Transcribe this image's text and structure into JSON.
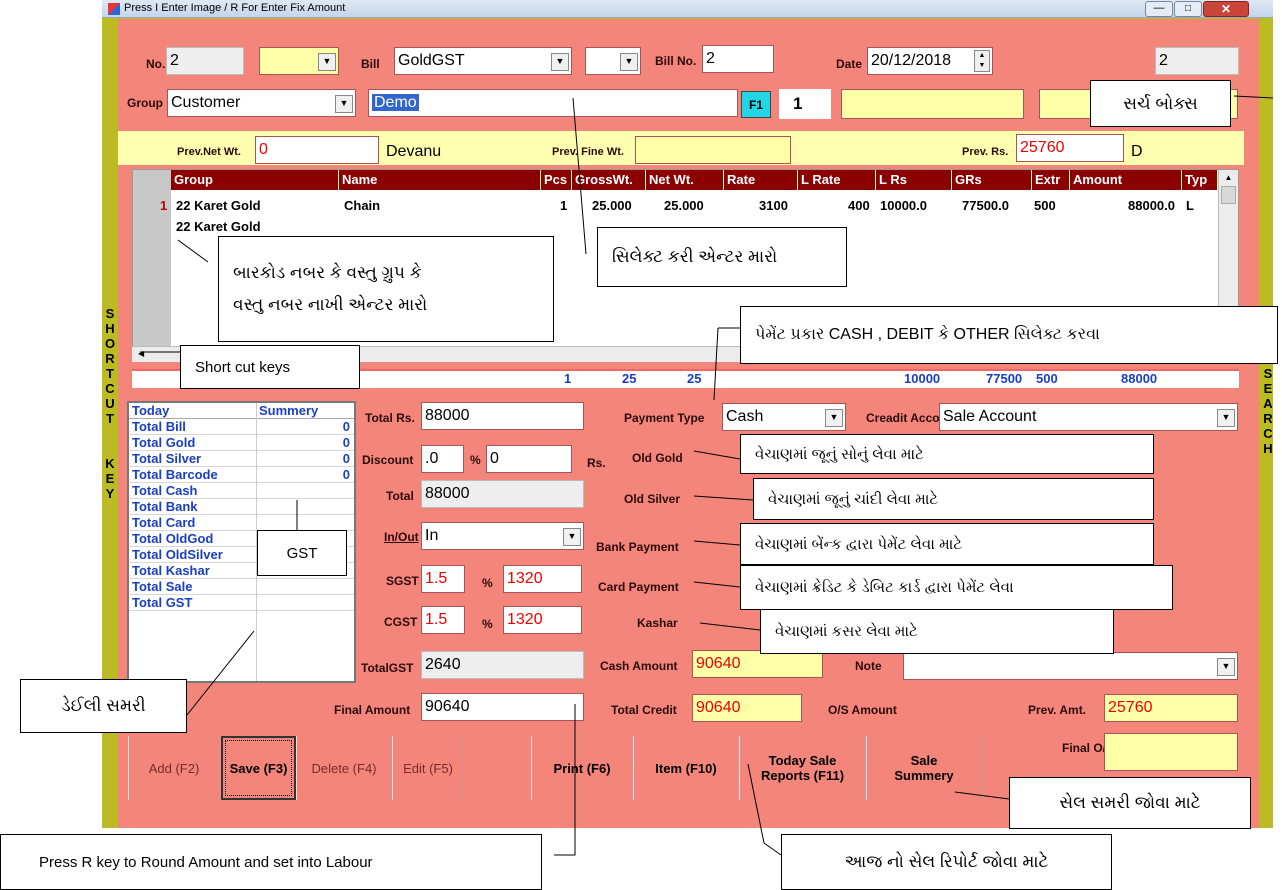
{
  "titlebar": {
    "title": "Press I Enter Image / R  For Enter Fix Amount"
  },
  "header": {
    "no_label": "No.",
    "no_value": "2",
    "bill_label": "Bill",
    "bill_value": "GoldGST",
    "billno_label": "Bill No.",
    "billno_value": "2",
    "date_label": "Date",
    "date_value": "20/12/2018",
    "right_value": "2",
    "group_label": "Group",
    "group_value": "Customer",
    "name_value": "Demo",
    "f1_label": "F1",
    "count_value": "1"
  },
  "prev": {
    "net_label": "Prev.Net Wt.",
    "net_value": "0",
    "devanu": "Devanu",
    "fine_label": "Prev. Fine Wt.",
    "rs_label": "Prev. Rs.",
    "rs_value": "25760",
    "d": "D"
  },
  "grid": {
    "columns": [
      "Group",
      "Name",
      "Pcs",
      "GrossWt.",
      "Net Wt.",
      "Rate",
      "L Rate",
      "L Rs",
      "GRs",
      "Extr",
      "Amount",
      "Typ"
    ],
    "rows": [
      {
        "no": "1",
        "group": "22 Karet Gold",
        "name": "Chain",
        "pcs": "1",
        "gross": "25.000",
        "net": "25.000",
        "rate": "3100",
        "lrate": "400",
        "lrs": "10000.0",
        "grs": "77500.0",
        "extr": "500",
        "amount": "88000.0",
        "typ": "L"
      },
      {
        "no": "",
        "group": "22 Karet Gold",
        "name": "",
        "pcs": "",
        "gross": "",
        "net": "",
        "rate": "",
        "lrate": "",
        "lrs": "",
        "grs": "",
        "extr": "",
        "amount": "",
        "typ": ""
      }
    ],
    "totals": {
      "pcs": "1",
      "gross": "25",
      "net": "25",
      "lrs": "10000",
      "grs": "77500",
      "extr": "500",
      "amount": "88000"
    }
  },
  "summary": {
    "header_left": "Today",
    "header_right": "Summery",
    "rows": [
      {
        "label": "Total Bill",
        "value": "0"
      },
      {
        "label": "Total Gold",
        "value": "0"
      },
      {
        "label": "Total Silver",
        "value": "0"
      },
      {
        "label": "Total Barcode",
        "value": "0"
      },
      {
        "label": "Total Cash",
        "value": ""
      },
      {
        "label": "Total Bank",
        "value": ""
      },
      {
        "label": "Total Card",
        "value": ""
      },
      {
        "label": "Total OldGod",
        "value": ""
      },
      {
        "label": "Total OldSilver",
        "value": ""
      },
      {
        "label": "Total Kashar",
        "value": ""
      },
      {
        "label": "Total Sale",
        "value": ""
      },
      {
        "label": "Total GST",
        "value": ""
      }
    ]
  },
  "form": {
    "totalrs_label": "Total Rs.",
    "totalrs_value": "88000",
    "discount_label": "Discount",
    "discount_value": ".0",
    "pct": "%",
    "discount_pct_value": "0",
    "rs": "Rs.",
    "total_label": "Total",
    "total_value": "88000",
    "inout_label": "In/Out",
    "inout_value": "In",
    "sgst_label": "SGST",
    "sgst_rate": "1.5",
    "sgst_amount": "1320",
    "cgst_label": "CGST",
    "cgst_rate": "1.5",
    "cgst_amount": "1320",
    "totalgst_label": "TotalGST",
    "totalgst_value": "2640",
    "final_label": "Final Amount",
    "final_value": "90640",
    "paytype_label": "Payment Type",
    "paytype_value": "Cash",
    "credit_label": "Creadit Account",
    "credit_value": "Sale Account",
    "oldgold_label": "Old Gold",
    "oldsilver_label": "Old Silver",
    "bankpay_label": "Bank Payment",
    "cardpay_label": "Card Payment",
    "kashar_label": "Kashar",
    "cash_label": "Cash Amount",
    "cash_value": "90640",
    "note_label": "Note",
    "totalcredit_label": "Total Credit",
    "totalcredit_value": "90640",
    "os_label": "O/S Amount",
    "prevamt_label": "Prev. Amt.",
    "prevamt_value": "25760",
    "finalos_label": "Final O/S"
  },
  "buttons": {
    "add": "Add (F2)",
    "save": "Save (F3)",
    "delete": "Delete (F4)",
    "edit": "Edit (F5)",
    "print": "Print (F6)",
    "item": "Item (F10)",
    "today": "Today Sale\nReports (F11)",
    "summery": "Sale\nSummery"
  },
  "side": {
    "left": "SHORTCUT KEY",
    "right": "SEARCH"
  },
  "callouts": {
    "search_box": "સર્ચ બોક્સ",
    "barcode": "બારકોડ નબર કે વસ્તુ ગ્રુપ કે\nવસ્તુ નબર નાખી એન્ટર મારો",
    "select_enter": "સિલેક્ટ કરી એન્ટર મારો",
    "payment_type": "પેમેંટ પ્રકાર CASH , DEBIT કે OTHER સિલેક્ટ કરવા",
    "shortcut": "Short cut keys",
    "old_gold": "વેચાણમાં જૂનું સોનું લેવા માટે",
    "old_silver": "વેચાણમાં જૂનું ચાંદી લેવા માટે",
    "bank": "વેચાણમાં બેંન્ક દ્વારા પેમેંટ લેવા માટે",
    "card": "વેચાણમાં ક્રેડિટ કે ડેબિટ કાર્ડ દ્વારા પેમેંટ લેવા",
    "kashar": "વેચાણમાં કસર લેવા માટે",
    "gst": "GST",
    "daily": "ડેઈલી સમરી",
    "sale_summary": "સેલ સમરી જોવા માટે",
    "round": "Press  R key to Round Amount and set into Labour",
    "today_report": "આજ નો સેલ રિપોર્ટ જોવા માટે"
  }
}
